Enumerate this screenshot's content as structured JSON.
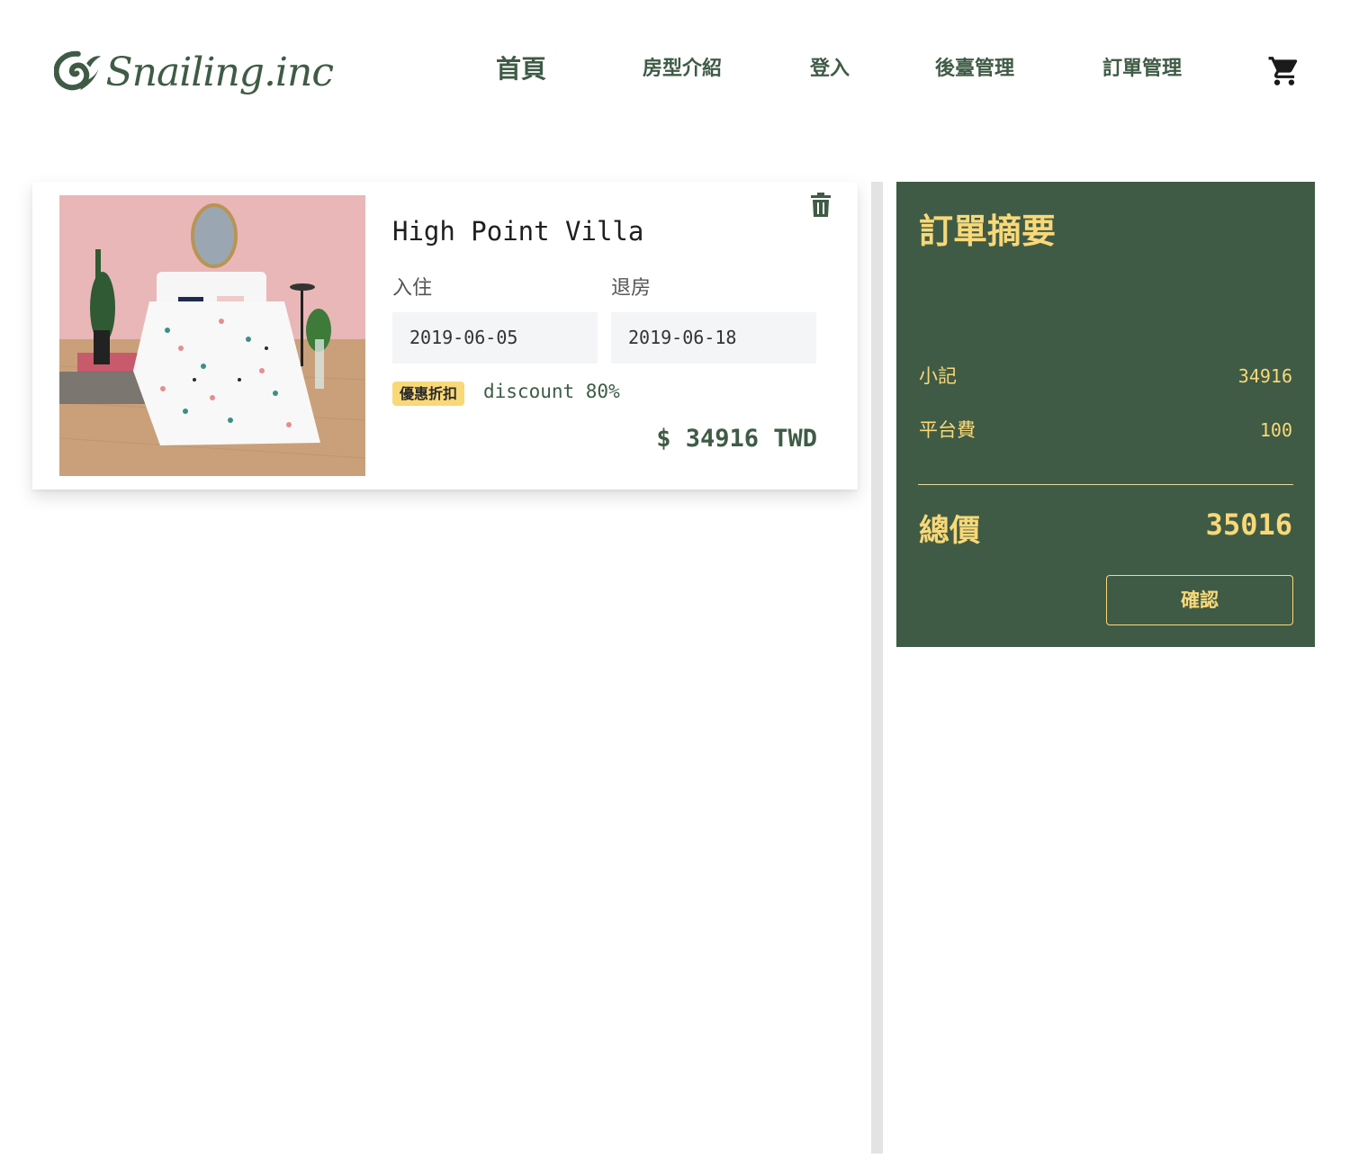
{
  "brand": {
    "name": "Snailing.inc",
    "color": "#3f5b45",
    "accent": "#f9d878"
  },
  "nav": {
    "home": "首頁",
    "rooms": "房型介紹",
    "login": "登入",
    "admin": "後臺管理",
    "orders": "訂單管理",
    "cart_icon": "shopping-cart-icon"
  },
  "cart_item": {
    "name": "High Point Villa",
    "image": "bedroom-photo",
    "checkin_label": "入住",
    "checkout_label": "退房",
    "checkin_date": "2019-06-05",
    "checkout_date": "2019-06-18",
    "badge": "優惠折扣",
    "discount": "discount 80%",
    "price": "$ 34916 TWD",
    "delete_icon": "trash-icon"
  },
  "summary": {
    "title": "訂單摘要",
    "subtotal_label": "小記",
    "subtotal_value": "34916",
    "fee_label": "平台費",
    "fee_value": "100",
    "total_label": "總價",
    "total_value": "35016",
    "confirm_label": "確認"
  }
}
